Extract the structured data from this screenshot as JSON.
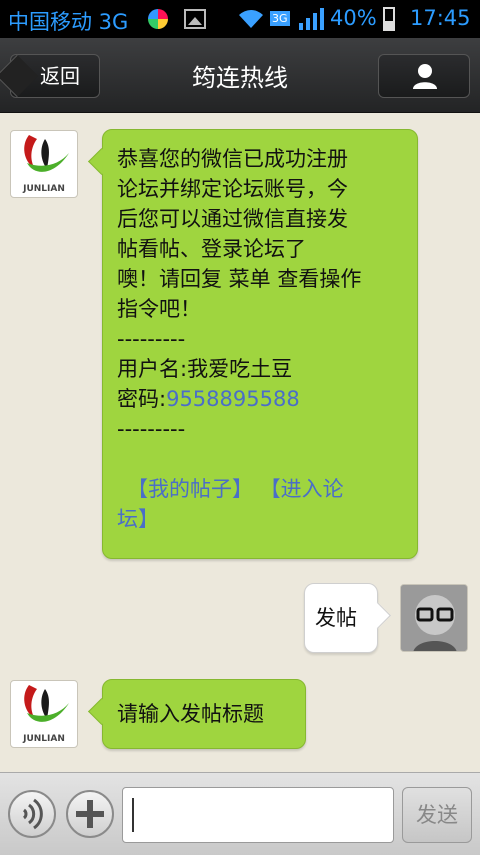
{
  "status_bar": {
    "carrier": "中国移动 3G",
    "network_badge": "3G",
    "battery_percent": "40%",
    "time": "17:45"
  },
  "header": {
    "back_label": "返回",
    "title": "筠连热线"
  },
  "messages": [
    {
      "side": "left",
      "sender_logo_text": "JUNLIAN",
      "lines": [
        "恭喜您的微信已成功注册",
        "论坛并绑定论坛账号，今",
        "后您可以通过微信直接发",
        "帖看帖、登录论坛了",
        "噢！请回复 菜单 查看操作",
        "指令吧！",
        "---------"
      ],
      "username_line": "用户名:我爱吃土豆",
      "password_label": "密码:",
      "password_value": "9558895588",
      "divider": "---------",
      "link_line1": "【我的帖子】 【进入论",
      "link_line2": "坛】"
    },
    {
      "side": "right",
      "text": "发帖"
    },
    {
      "side": "left",
      "sender_logo_text": "JUNLIAN",
      "text": "请输入发帖标题"
    }
  ],
  "input_bar": {
    "send_label": "发送",
    "input_value": ""
  }
}
